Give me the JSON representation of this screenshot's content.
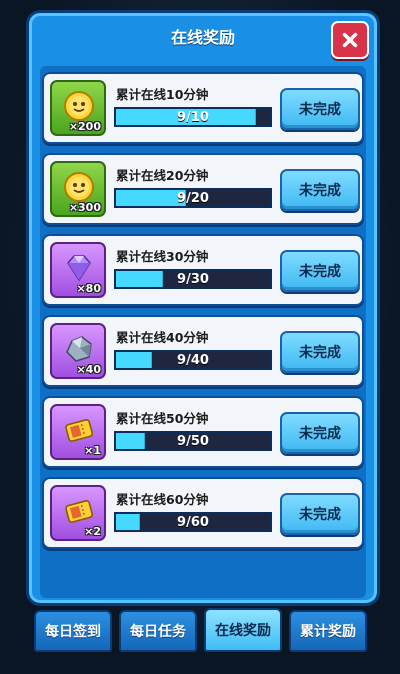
{
  "title": "在线奖励",
  "status_label": "未完成",
  "rewards": [
    {
      "title": "累计在线10分钟",
      "count": "×200",
      "progress": "9/10",
      "fraction": 0.9,
      "icon": "coin-icon",
      "color": "green"
    },
    {
      "title": "累计在线20分钟",
      "count": "×300",
      "progress": "9/20",
      "fraction": 0.45,
      "icon": "coin-icon",
      "color": "green"
    },
    {
      "title": "累计在线30分钟",
      "count": "×80",
      "progress": "9/30",
      "fraction": 0.3,
      "icon": "diamond-icon",
      "color": "purple"
    },
    {
      "title": "累计在线40分钟",
      "count": "×40",
      "progress": "9/40",
      "fraction": 0.225,
      "icon": "stone-icon",
      "color": "purple"
    },
    {
      "title": "累计在线50分钟",
      "count": "×1",
      "progress": "9/50",
      "fraction": 0.18,
      "icon": "ticket-icon",
      "color": "purple"
    },
    {
      "title": "累计在线60分钟",
      "count": "×2",
      "progress": "9/60",
      "fraction": 0.15,
      "icon": "ticket-icon",
      "color": "purple"
    }
  ],
  "tabs": [
    {
      "label": "每日签到",
      "active": false
    },
    {
      "label": "每日任务",
      "active": false
    },
    {
      "label": "在线奖励",
      "active": true
    },
    {
      "label": "累计奖励",
      "active": false
    }
  ]
}
